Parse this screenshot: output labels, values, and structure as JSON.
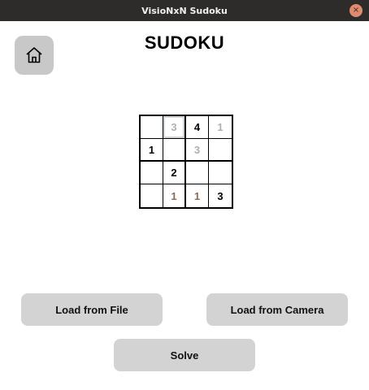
{
  "window": {
    "title": "VisioNxN Sudoku",
    "close_symbol": "×"
  },
  "header": {
    "title": "SUDOKU",
    "home_icon": "home-icon"
  },
  "board": {
    "rows": [
      [
        {
          "v": "",
          "t": "empty"
        },
        {
          "v": "3",
          "t": "gray",
          "sel": true
        },
        {
          "v": "4",
          "t": "given"
        },
        {
          "v": "1",
          "t": "gray"
        }
      ],
      [
        {
          "v": "1",
          "t": "given"
        },
        {
          "v": "",
          "t": "empty"
        },
        {
          "v": "3",
          "t": "gray"
        },
        {
          "v": "",
          "t": "empty"
        }
      ],
      [
        {
          "v": "",
          "t": "empty"
        },
        {
          "v": "2",
          "t": "given"
        },
        {
          "v": "",
          "t": "empty"
        },
        {
          "v": "",
          "t": "empty"
        }
      ],
      [
        {
          "v": "",
          "t": "empty"
        },
        {
          "v": "1",
          "t": "brown"
        },
        {
          "v": "1",
          "t": "brown"
        },
        {
          "v": "3",
          "t": "given"
        }
      ]
    ]
  },
  "buttons": {
    "load_file": "Load from File",
    "load_camera": "Load from Camera",
    "solve": "Solve"
  },
  "colors": {
    "titlebar": "#2d2c2b",
    "button_bg": "#d3d3d3",
    "close_btn": "#e08a70",
    "hint_gray": "#b0b0b0",
    "hint_brown": "#8a6a5a"
  }
}
